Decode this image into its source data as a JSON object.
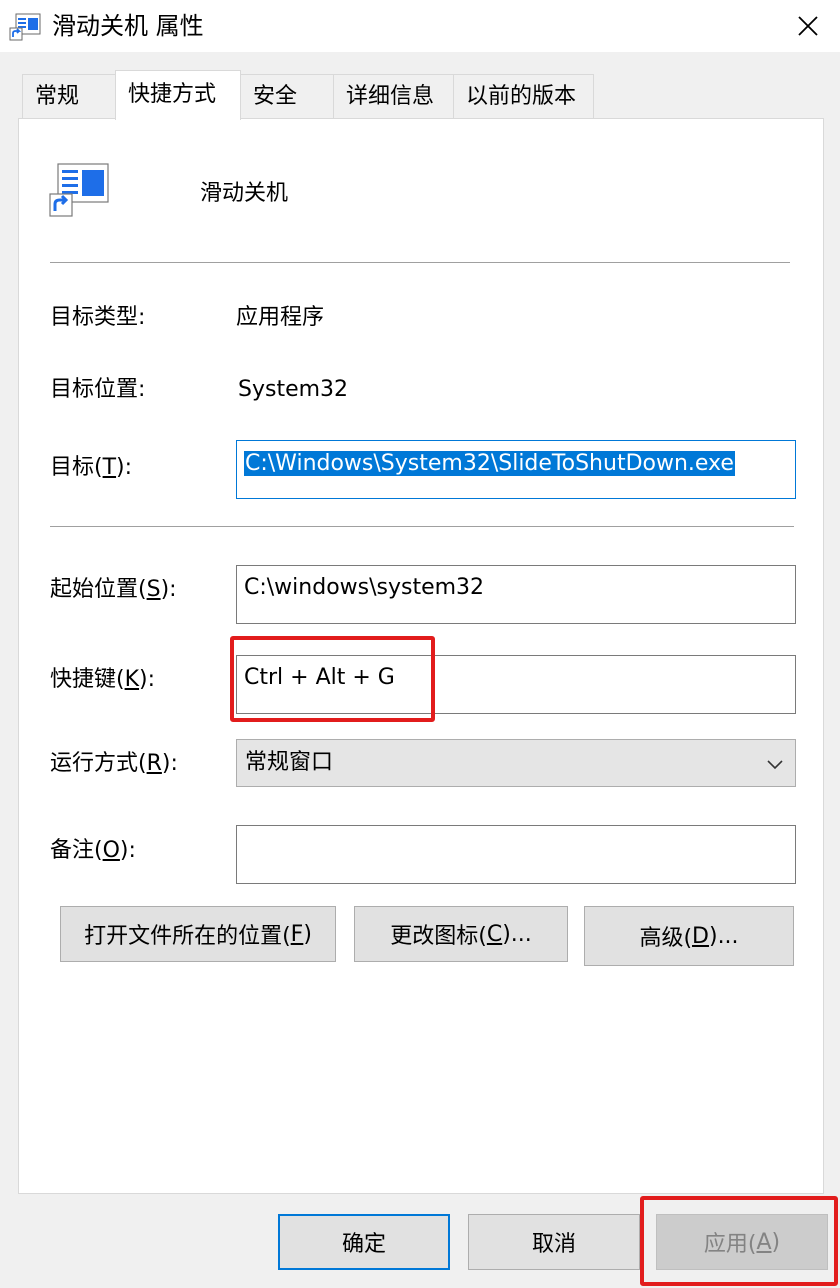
{
  "window": {
    "title": "滑动关机 属性",
    "close_icon": "close-icon"
  },
  "tabs": [
    {
      "label": "常规"
    },
    {
      "label": "快捷方式"
    },
    {
      "label": "安全"
    },
    {
      "label": "详细信息"
    },
    {
      "label": "以前的版本"
    }
  ],
  "shortcut": {
    "name": "滑动关机",
    "target_type_label": "目标类型:",
    "target_type_value": "应用程序",
    "target_location_label": "目标位置:",
    "target_location_value": "System32",
    "target_label_pre": "目标(",
    "target_label_key": "T",
    "target_label_post": "):",
    "target_value": "C:\\Windows\\System32\\SlideToShutDown.exe",
    "start_in_label_pre": "起始位置(",
    "start_in_label_key": "S",
    "start_in_label_post": "):",
    "start_in_value": "C:\\windows\\system32",
    "hotkey_label_pre": "快捷键(",
    "hotkey_label_key": "K",
    "hotkey_label_post": "):",
    "hotkey_value": "Ctrl + Alt + G",
    "run_label_pre": "运行方式(",
    "run_label_key": "R",
    "run_label_post": "):",
    "run_value": "常规窗口",
    "comment_label_pre": "备注(",
    "comment_label_key": "O",
    "comment_label_post": "):",
    "comment_value": ""
  },
  "actions": {
    "open_location_pre": "打开文件所在的位置(",
    "open_location_key": "F",
    "open_location_post": ")",
    "change_icon_pre": "更改图标(",
    "change_icon_key": "C",
    "change_icon_post": ")...",
    "advanced_pre": "高级(",
    "advanced_key": "D",
    "advanced_post": ")..."
  },
  "footer": {
    "ok": "确定",
    "cancel": "取消",
    "apply_pre": "应用(",
    "apply_key": "A",
    "apply_post": ")"
  },
  "colors": {
    "selection": "#0078d7",
    "highlight_box": "#e21c1c"
  }
}
